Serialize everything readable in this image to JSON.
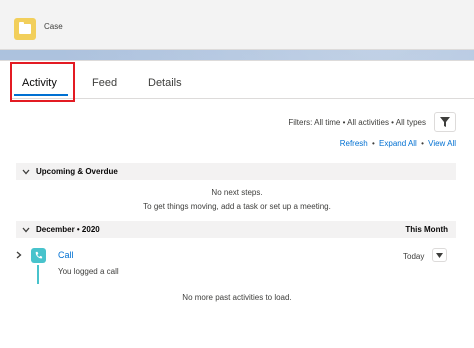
{
  "header": {
    "object_label": "Case"
  },
  "tabs": [
    {
      "label": "Activity",
      "active": true
    },
    {
      "label": "Feed",
      "active": false
    },
    {
      "label": "Details",
      "active": false
    }
  ],
  "filters": {
    "text": "Filters: All time • All activities • All types",
    "icon": "filter-icon"
  },
  "links": {
    "refresh": "Refresh",
    "sep": "•",
    "expand_all": "Expand All",
    "view_all": "View All"
  },
  "upcoming": {
    "title": "Upcoming & Overdue",
    "empty_line1": "No next steps.",
    "empty_line2": "To get things moving, add a task or set up a meeting."
  },
  "past": {
    "title": "December • 2020",
    "badge": "This Month",
    "items": [
      {
        "title": "Call",
        "subtitle": "You logged a call",
        "date": "Today",
        "icon": "call-icon"
      }
    ],
    "footer": "No more past activities to load."
  },
  "colors": {
    "accent": "#0070d2",
    "highlight": "#e31b23",
    "call": "#48c3cc",
    "case_icon": "#f2cf5b"
  }
}
